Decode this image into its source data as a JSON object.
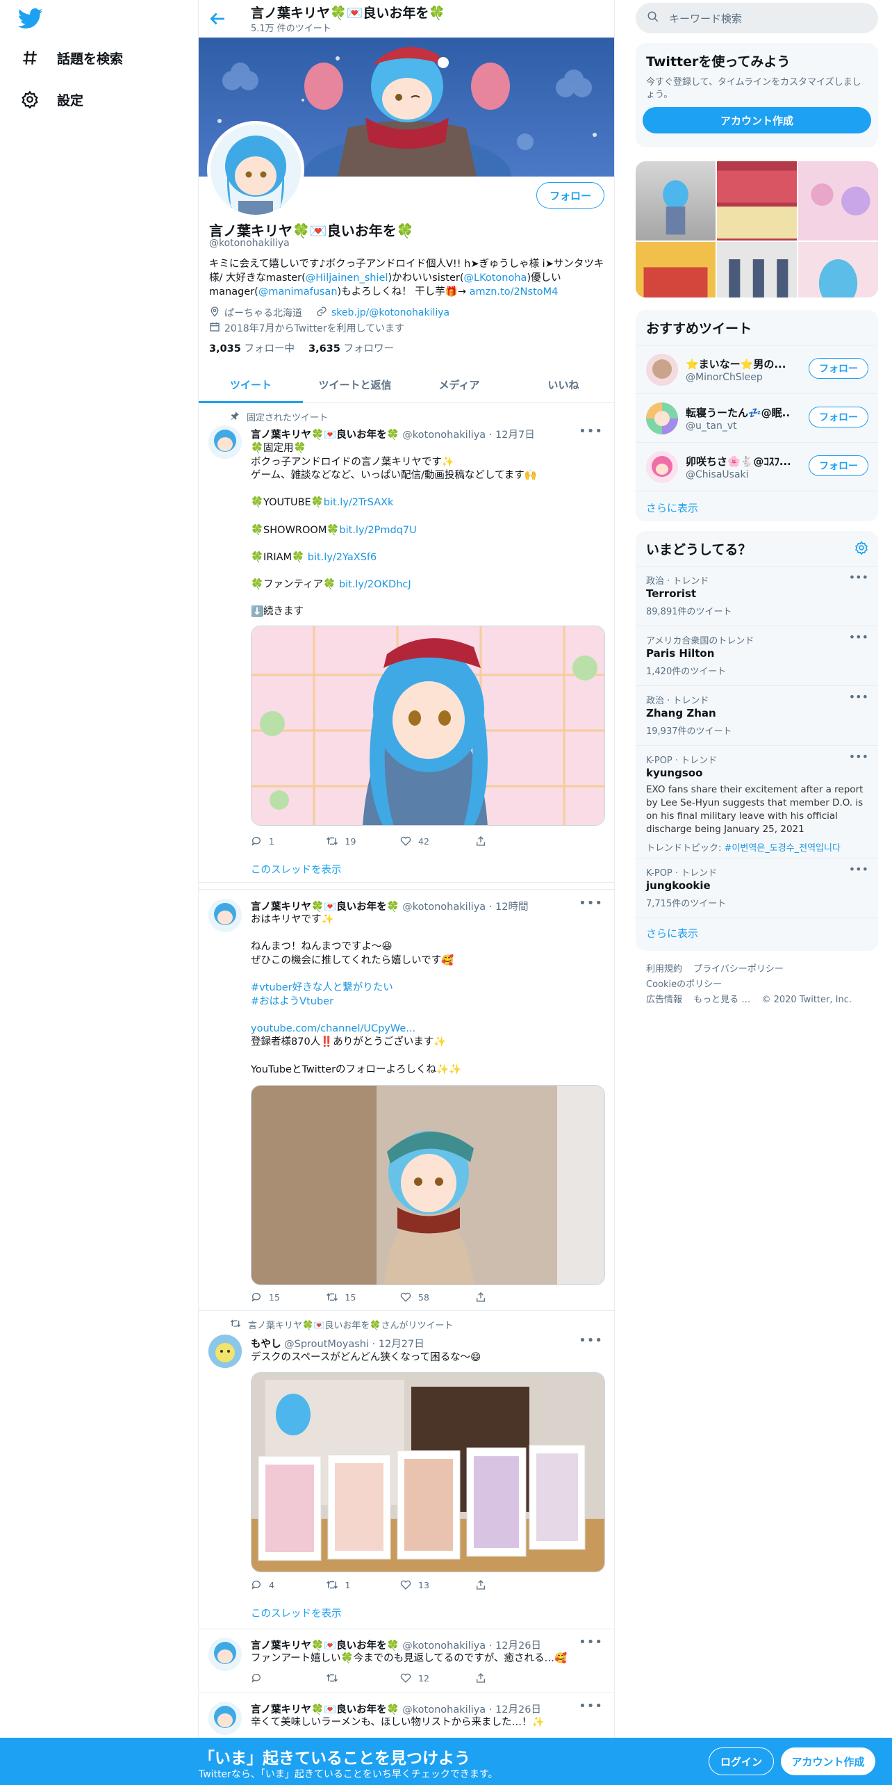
{
  "nav": {
    "explore_label": "話題を検索",
    "settings_label": "設定"
  },
  "header": {
    "title": "言ノ葉キリヤ🍀💌良いお年を🍀",
    "tweet_count": "5.1万 件のツイート"
  },
  "profile": {
    "name": "言ノ葉キリヤ🍀💌良いお年を🍀",
    "handle": "@kotonohakiliya",
    "follow_label": "フォロー",
    "bio_1": "キミに会えて嬉しいです♪ボクっ子アンドロイド個人V!! h➤ぎゅうしゃ様 i➤サンタツキ様/ 大好きなmaster(",
    "bio_link1": "@Hiljainen_shiel",
    "bio_2": ")かわいいsister(",
    "bio_link2": "@LKotonoha",
    "bio_3": ")優しいmanager(",
    "bio_link3": "@manimafusan",
    "bio_4": ")もよろしくね！ 干し芋🎁→ ",
    "bio_link4": "amzn.to/2NstoM4",
    "location": "ぱーちゃる北海道",
    "website": "skeb.jp/@kotonohakiliya",
    "joined": "2018年7月からTwitterを利用しています",
    "following_count": "3,035",
    "following_label": "フォロー中",
    "followers_count": "3,635",
    "followers_label": "フォロワー"
  },
  "tabs": [
    "ツイート",
    "ツイートと返信",
    "メディア",
    "いいね"
  ],
  "tweets": [
    {
      "pinned_label": "固定されたツイート",
      "name": "言ノ葉キリヤ🍀💌良いお年を🍀",
      "handle": "@kotonohakiliya",
      "time": "12月7日",
      "lines": [
        "🍀固定用🍀",
        "ボクっ子アンドロイドの言ノ葉キリヤです✨",
        "ゲーム、雑談などなど、いっぱい配信/動画投稿などしてます🙌"
      ],
      "link_lines": [
        {
          "prefix": "🍀YOUTUBE🍀",
          "link": "bit.ly/2TrSAXk"
        },
        {
          "prefix": "🍀SHOWROOM🍀",
          "link": "bit.ly/2Pmdq7U"
        },
        {
          "prefix": "🍀IRIAM🍀 ",
          "link": "bit.ly/2YaXSf6"
        },
        {
          "prefix": "🍀ファンティア🍀 ",
          "link": "bit.ly/2OKDhcJ"
        }
      ],
      "continue": "⬇️続きます",
      "replies": "1",
      "retweets": "19",
      "likes": "42",
      "show_thread": "このスレッドを表示"
    },
    {
      "name": "言ノ葉キリヤ🍀💌良いお年を🍀",
      "handle": "@kotonohakiliya",
      "time": "12時間",
      "line1": "おはキリヤです✨",
      "line2": "ねんまつ！ねんまつですよ～😆",
      "line3": "ぜひこの機会に推してくれたら嬉しいです🥰",
      "tag1": "#vtuber好きな人と繋がりたい",
      "tag2": "#おはようVtuber",
      "link": "youtube.com/channel/UCpyWe...",
      "line4": "登録者様870人‼️ありがとうございます✨",
      "line5": "YouTubeとTwitterのフォローよろしくね✨✨",
      "replies": "15",
      "retweets": "15",
      "likes": "58"
    },
    {
      "retweet_label": "言ノ葉キリヤ🍀💌良いお年を🍀さんがリツイート",
      "name": "もやし",
      "handle": "@SproutMoyashi",
      "time": "12月27日",
      "line1": "デスクのスペースがどんどん狭くなって困るな～😄",
      "replies": "4",
      "retweets": "1",
      "likes": "13",
      "show_thread": "このスレッドを表示"
    },
    {
      "name": "言ノ葉キリヤ🍀💌良いお年を🍀",
      "handle": "@kotonohakiliya",
      "time": "12月26日",
      "line1": "ファンアート嬉しい🍀今までのも見返してるのですが、癒される…🥰",
      "likes": "12"
    },
    {
      "name": "言ノ葉キリヤ🍀💌良いお年を🍀",
      "handle": "@kotonohakiliya",
      "time": "12月26日",
      "line1": "辛くて美味しいラーメンも、ほしい物リストから来ました…！✨"
    }
  ],
  "right": {
    "search_placeholder": "キーワード検索",
    "signup_card": {
      "title": "Twitterを使ってみよう",
      "desc": "今すぐ登録して、タイムラインをカスタマイズしましょう。",
      "button": "アカウント作成"
    },
    "recommended": {
      "title": "おすすめツイート",
      "users": [
        {
          "name": "⭐まいなー⭐男の...",
          "handle": "@MinorChSleep",
          "button": "フォロー"
        },
        {
          "name": "転寝うーたん💤@眠...",
          "handle": "@u_tan_vt",
          "button": "フォロー"
        },
        {
          "name": "卯咲ちさ🌸🐇@ｺｽﾌ...",
          "handle": "@ChisaUsaki",
          "button": "フォロー"
        }
      ],
      "show_more": "さらに表示"
    },
    "trends": {
      "title": "いまどうしてる？",
      "items": [
        {
          "context": "政治 · トレンド",
          "name": "Terrorist",
          "count": "89,891件のツイート"
        },
        {
          "context": "アメリカ合衆国のトレンド",
          "name": "Paris Hilton",
          "count": "1,420件のツイート"
        },
        {
          "context": "政治 · トレンド",
          "name": "Zhang Zhan",
          "count": "19,937件のツイート"
        },
        {
          "context": "K-POP · トレンド",
          "name": "kyungsoo",
          "desc": "EXO fans share their excitement after a report by Lee Se-Hyun suggests that member D.O. is on his final military leave with his official discharge being January 25, 2021",
          "topic_label": "トレンドトピック: ",
          "topic": "#이번역은_도경수_전역입니다"
        },
        {
          "context": "K-POP · トレンド",
          "name": "jungkookie",
          "count": "7,715件のツイート"
        }
      ],
      "show_more": "さらに表示"
    },
    "footer": [
      "利用規約",
      "プライバシーポリシー",
      "Cookieのポリシー",
      "広告情報",
      "もっと見る …",
      "© 2020 Twitter, Inc."
    ]
  },
  "bottom_bar": {
    "headline": "「いま」起きていることを見つけよう",
    "sub": "Twitterなら、「いま」起きていることをいち早くチェックできます。",
    "login": "ログイン",
    "signup": "アカウント作成"
  },
  "colors": {
    "accent": "#1da1f2",
    "link": "#1b95e0"
  }
}
